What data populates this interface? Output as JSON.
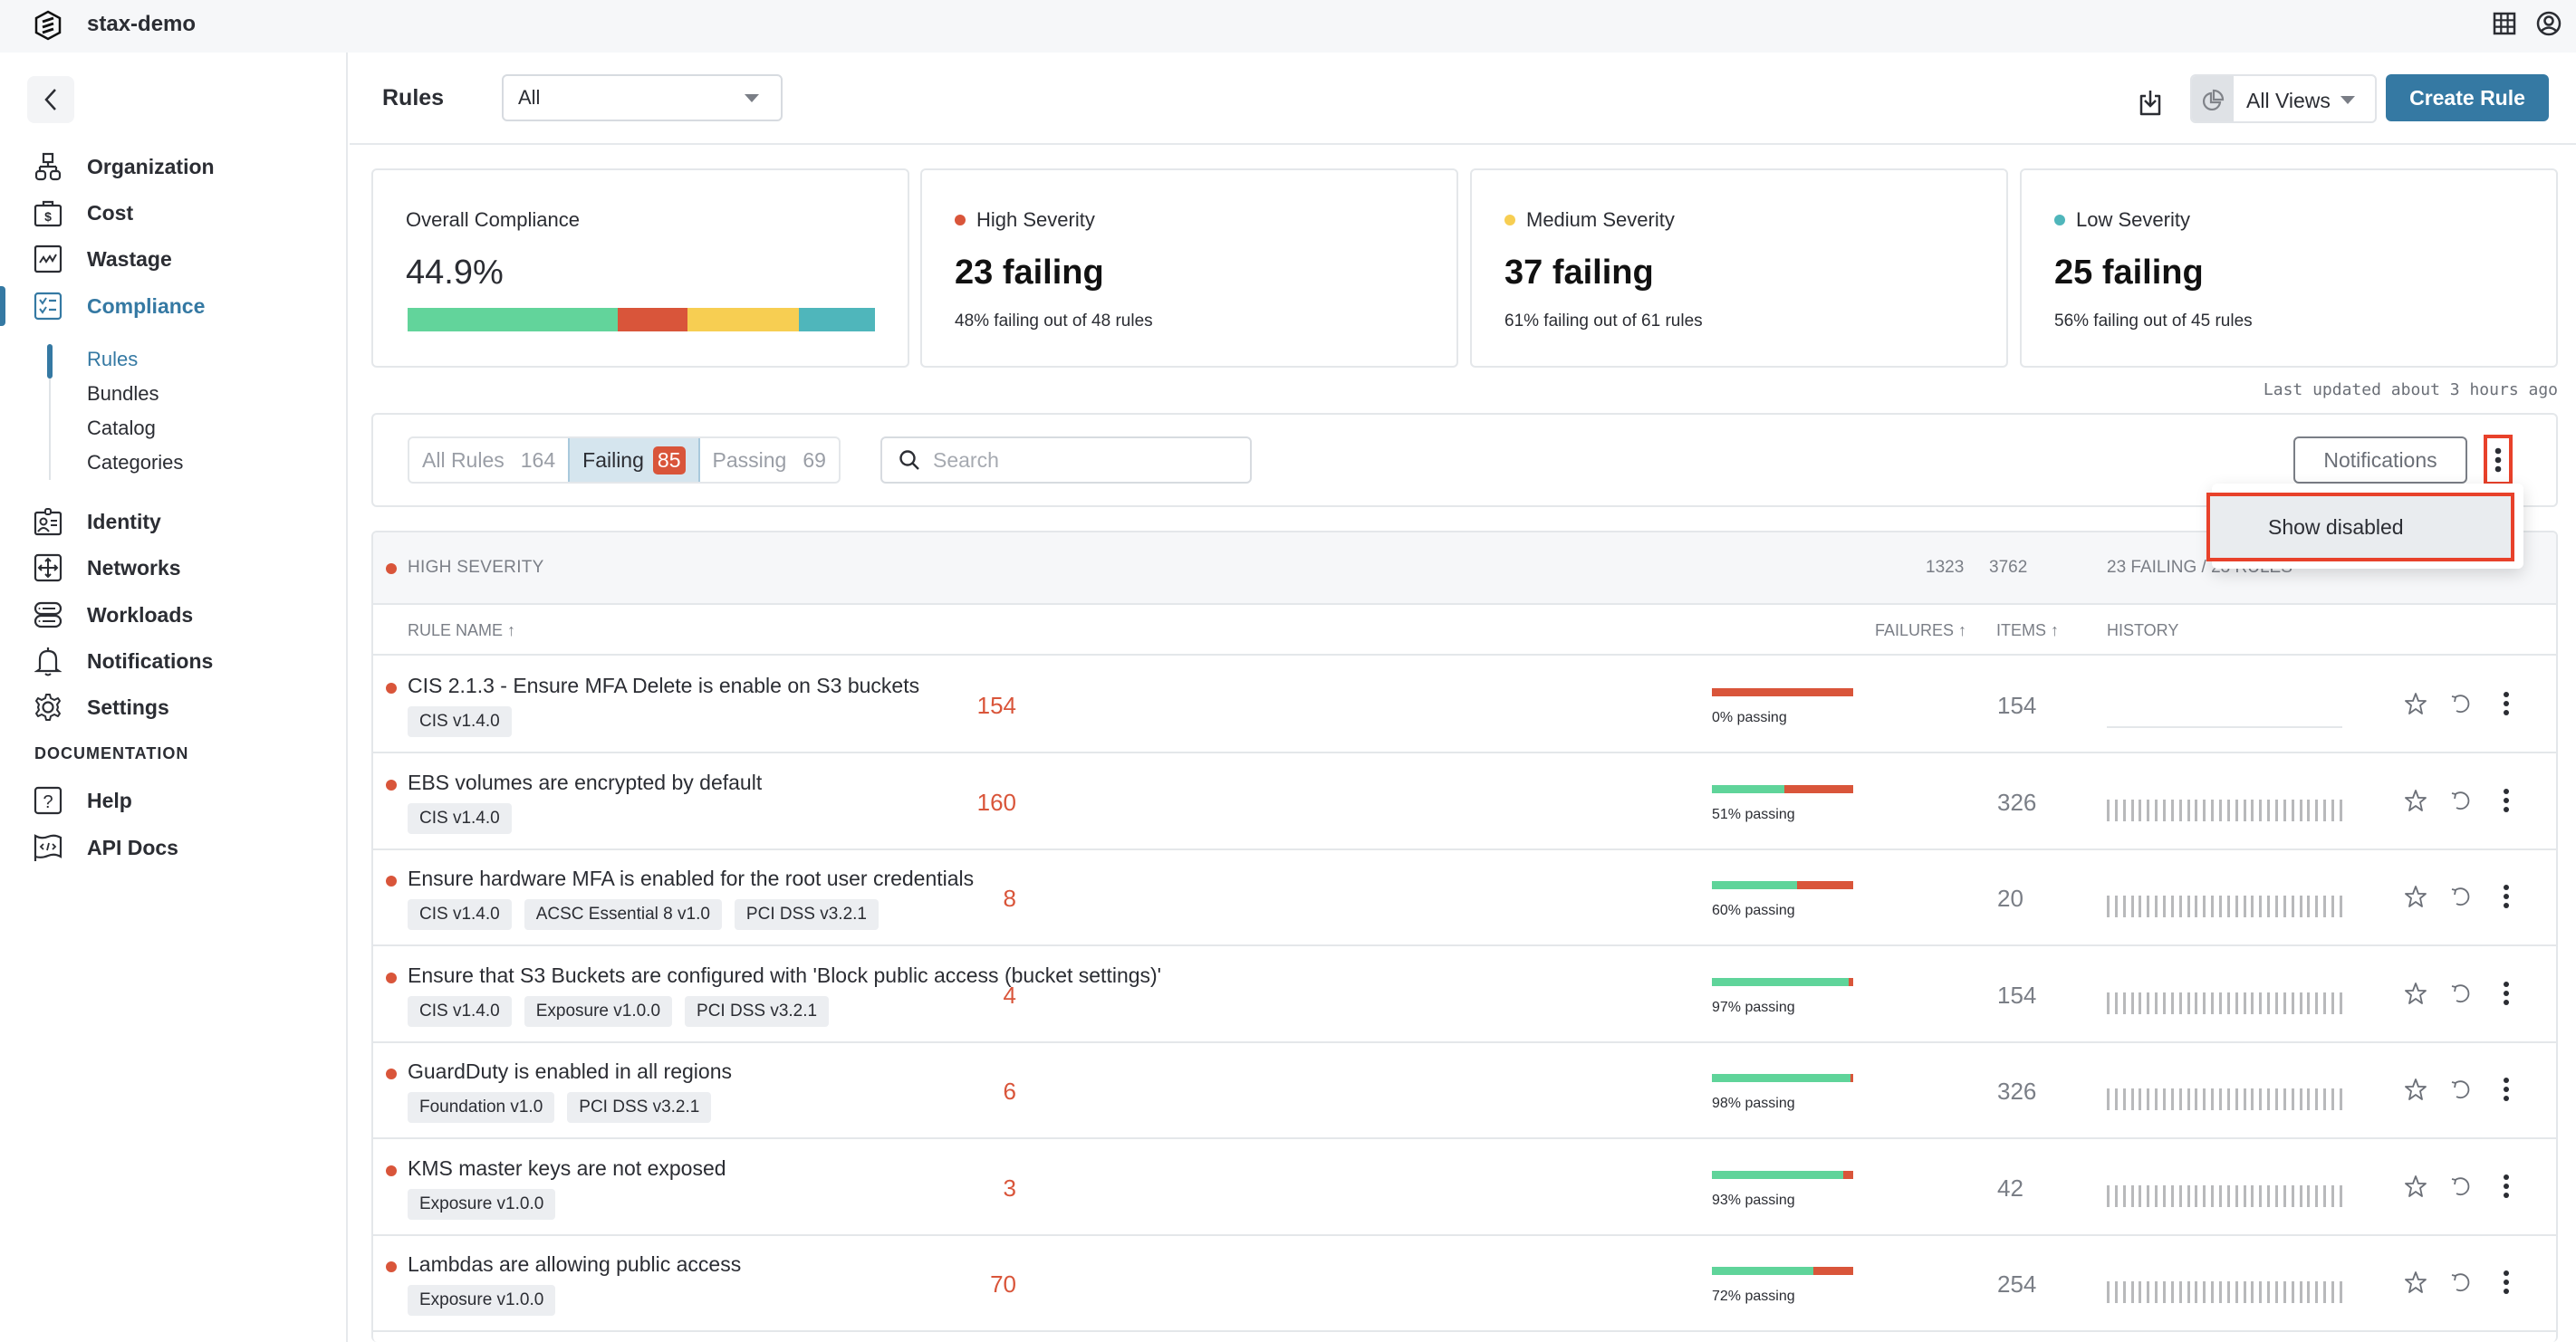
{
  "topbar": {
    "brand": "stax-demo",
    "icons": [
      "stax-logo-icon",
      "apps-grid-icon",
      "user-account-icon"
    ]
  },
  "sidebar": {
    "back_icon": "chevron-left-icon",
    "items": [
      {
        "label": "Organization",
        "icon": "org-chart-icon"
      },
      {
        "label": "Cost",
        "icon": "money-bag-icon"
      },
      {
        "label": "Wastage",
        "icon": "line-chart-icon"
      },
      {
        "label": "Compliance",
        "icon": "checklist-icon",
        "active": true
      }
    ],
    "compliance_sub": [
      {
        "label": "Rules",
        "active": true
      },
      {
        "label": "Bundles"
      },
      {
        "label": "Catalog"
      },
      {
        "label": "Categories"
      }
    ],
    "items2": [
      {
        "label": "Identity",
        "icon": "id-card-icon"
      },
      {
        "label": "Networks",
        "icon": "network-arrows-icon"
      },
      {
        "label": "Workloads",
        "icon": "server-stack-icon"
      },
      {
        "label": "Notifications",
        "icon": "bell-icon"
      },
      {
        "label": "Settings",
        "icon": "gear-icon"
      }
    ],
    "documentation_header": "DOCUMENTATION",
    "docs": [
      {
        "label": "Help",
        "icon": "help-question-icon"
      },
      {
        "label": "API Docs",
        "icon": "code-flag-icon"
      }
    ]
  },
  "header": {
    "title": "Rules",
    "filter_select": "All",
    "views_select": "All Views",
    "create_button": "Create Rule"
  },
  "summary": {
    "overall": {
      "title": "Overall Compliance",
      "value": "44.9%",
      "bar_segments": [
        {
          "name": "passing",
          "fraction": 0.449,
          "color": "#62d49b"
        },
        {
          "name": "high",
          "fraction": 0.149,
          "color": "#d9553a"
        },
        {
          "name": "medium",
          "fraction": 0.24,
          "color": "#f7ce52"
        },
        {
          "name": "low",
          "fraction": 0.162,
          "color": "#4fb6bb"
        }
      ]
    },
    "severity_cards": [
      {
        "title": "High Severity",
        "value": "23 failing",
        "sub": "48% failing out of 48 rules",
        "color": "#d9553a"
      },
      {
        "title": "Medium Severity",
        "value": "37 failing",
        "sub": "61% failing out of 61 rules",
        "color": "#f7ce52"
      },
      {
        "title": "Low Severity",
        "value": "25 failing",
        "sub": "56% failing out of 45 rules",
        "color": "#4fb6bb"
      }
    ],
    "last_updated": "Last updated about 3 hours ago"
  },
  "filters": {
    "tabs": [
      {
        "label": "All Rules",
        "count": "164"
      },
      {
        "label": "Failing",
        "count": "85",
        "active": true
      },
      {
        "label": "Passing",
        "count": "69"
      }
    ],
    "search_placeholder": "Search",
    "search_value": "",
    "notifications_button": "Notifications"
  },
  "menu": {
    "items": [
      "Show disabled"
    ]
  },
  "table": {
    "group": {
      "label": "HIGH SEVERITY",
      "failures_total": "1323",
      "items_total": "3762",
      "summary": "23 FAILING / 23 RULES"
    },
    "columns": {
      "rule_name": "RULE NAME ↑",
      "failures": "FAILURES ↑",
      "items": "ITEMS ↑",
      "history": "HISTORY"
    },
    "rows": [
      {
        "name": "CIS 2.1.3 - Ensure MFA Delete is enable on S3 buckets",
        "tags": [
          "CIS v1.4.0"
        ],
        "passing_pct": 0,
        "passing_text": "0% passing",
        "failures": "154",
        "items": "154",
        "history": false
      },
      {
        "name": "EBS volumes are encrypted by default",
        "tags": [
          "CIS v1.4.0"
        ],
        "passing_pct": 51,
        "passing_text": "51% passing",
        "failures": "160",
        "items": "326",
        "history": true
      },
      {
        "name": "Ensure hardware MFA is enabled for the root user credentials",
        "tags": [
          "CIS v1.4.0",
          "ACSC Essential 8 v1.0",
          "PCI DSS v3.2.1"
        ],
        "passing_pct": 60,
        "passing_text": "60% passing",
        "failures": "8",
        "items": "20",
        "history": true
      },
      {
        "name": "Ensure that S3 Buckets are configured with 'Block public access (bucket settings)'",
        "tags": [
          "CIS v1.4.0",
          "Exposure v1.0.0",
          "PCI DSS v3.2.1"
        ],
        "passing_pct": 97,
        "passing_text": "97% passing",
        "failures": "4",
        "items": "154",
        "history": true
      },
      {
        "name": "GuardDuty is enabled in all regions",
        "tags": [
          "Foundation v1.0",
          "PCI DSS v3.2.1"
        ],
        "passing_pct": 98,
        "passing_text": "98% passing",
        "failures": "6",
        "items": "326",
        "history": true
      },
      {
        "name": "KMS master keys are not exposed",
        "tags": [
          "Exposure v1.0.0"
        ],
        "passing_pct": 93,
        "passing_text": "93% passing",
        "failures": "3",
        "items": "42",
        "history": true
      },
      {
        "name": "Lambdas are allowing public access",
        "tags": [
          "Exposure v1.0.0"
        ],
        "passing_pct": 72,
        "passing_text": "72% passing",
        "failures": "70",
        "items": "254",
        "history": true
      }
    ],
    "row_actions": [
      "star-icon",
      "rerun-icon",
      "more-vertical-icon"
    ]
  }
}
